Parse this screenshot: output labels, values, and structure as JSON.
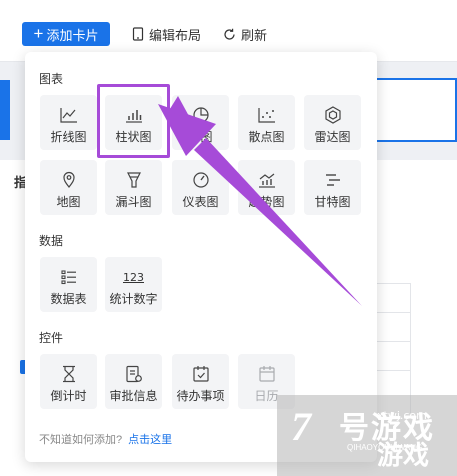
{
  "toolbar": {
    "add_card_label": "添加卡片",
    "edit_layout_label": "编辑布局",
    "refresh_label": "刷新"
  },
  "background": {
    "left_heading": "指"
  },
  "panel": {
    "sections": {
      "charts": "图表",
      "data": "数据",
      "controls": "控件"
    },
    "charts": [
      {
        "label": "折线图",
        "icon": "line-chart-icon"
      },
      {
        "label": "柱状图",
        "icon": "bar-chart-icon"
      },
      {
        "label": "饼图",
        "icon": "pie-chart-icon"
      },
      {
        "label": "散点图",
        "icon": "scatter-chart-icon"
      },
      {
        "label": "雷达图",
        "icon": "radar-chart-icon"
      },
      {
        "label": "地图",
        "icon": "map-icon"
      },
      {
        "label": "漏斗图",
        "icon": "funnel-chart-icon"
      },
      {
        "label": "仪表图",
        "icon": "gauge-chart-icon"
      },
      {
        "label": "趋势图",
        "icon": "trend-chart-icon"
      },
      {
        "label": "甘特图",
        "icon": "gantt-chart-icon"
      }
    ],
    "data": [
      {
        "label": "数据表",
        "icon": "data-table-icon"
      },
      {
        "label": "统计数字",
        "icon": "statistic-number-icon",
        "glyph": "123"
      }
    ],
    "controls": [
      {
        "label": "倒计时",
        "icon": "hourglass-icon"
      },
      {
        "label": "审批信息",
        "icon": "approval-icon"
      },
      {
        "label": "待办事项",
        "icon": "todo-icon"
      },
      {
        "label": "日历",
        "icon": "calendar-icon"
      }
    ],
    "footer": {
      "question": "不知道如何添加?",
      "link": "点击这里"
    }
  },
  "colors": {
    "primary": "#1a73e8",
    "highlight": "#a64bd8"
  }
}
